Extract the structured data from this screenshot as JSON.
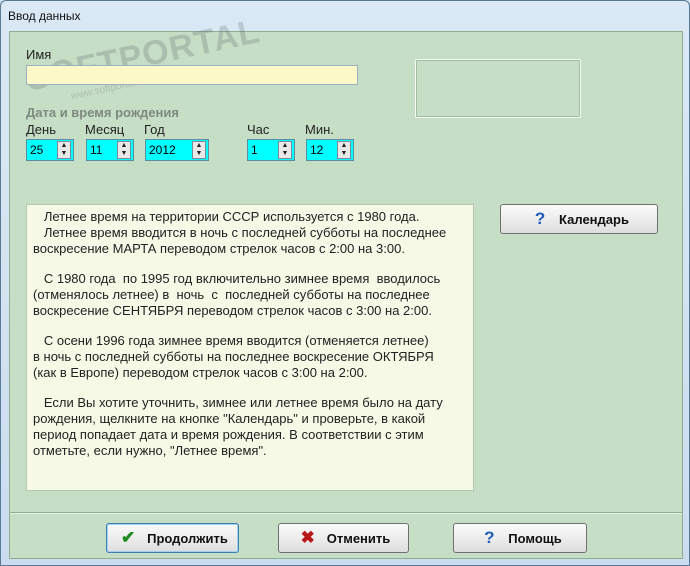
{
  "window": {
    "title": "Ввод данных"
  },
  "watermark": {
    "brand": "SOFTPORTAL",
    "url": "www.softportal.com"
  },
  "form": {
    "name_label": "Имя",
    "name_value": "",
    "datetime_label": "Дата и время рождения",
    "day": {
      "label": "День",
      "value": "25"
    },
    "month": {
      "label": "Месяц",
      "value": "11"
    },
    "year": {
      "label": "Год",
      "value": "2012"
    },
    "hour": {
      "label": "Час",
      "value": "1"
    },
    "minute": {
      "label": "Мин.",
      "value": "12"
    }
  },
  "info": {
    "paragraphs": [
      "   Летнее время на территории СССР используется с 1980 года.\n   Летнее время вводится в ночь с последней субботы на последнее\nвоскресение МАРТА переводом стрелок часов с 2:00 на 3:00.",
      "   С 1980 года  по 1995 год включительно зимнее время  вводилось\n(отменялось летнее) в  ночь  с  последней субботы на последнее\nвоскресение СЕНТЯБРЯ переводом стрелок часов с 3:00 на 2:00.",
      "   С осени 1996 года зимнее время вводится (отменяется летнее)\nв ночь с последней субботы на последнее воскресение ОКТЯБРЯ\n(как в Европе) переводом стрелок часов с 3:00 на 2:00.",
      "   Если Вы хотите уточнить, зимнее или летнее время было на дату\nрождения, щелкните на кнопке \"Календарь\" и проверьте, в какой\nпериод попадает дата и время рождения. В соответствии с этим\nотметьте, если нужно, \"Летнее время\"."
    ]
  },
  "buttons": {
    "calendar": "Календарь",
    "continue": "Продолжить",
    "cancel": "Отменить",
    "help": "Помощь"
  },
  "icons": {
    "calendar": "question-icon",
    "continue": "checkmark-icon",
    "cancel": "cross-icon",
    "help": "question-icon"
  },
  "colors": {
    "client_bg": "#c6ddc6",
    "spin_bg": "#00ffff",
    "name_bg": "#fcf8c8",
    "info_bg": "#f5f9e6"
  }
}
